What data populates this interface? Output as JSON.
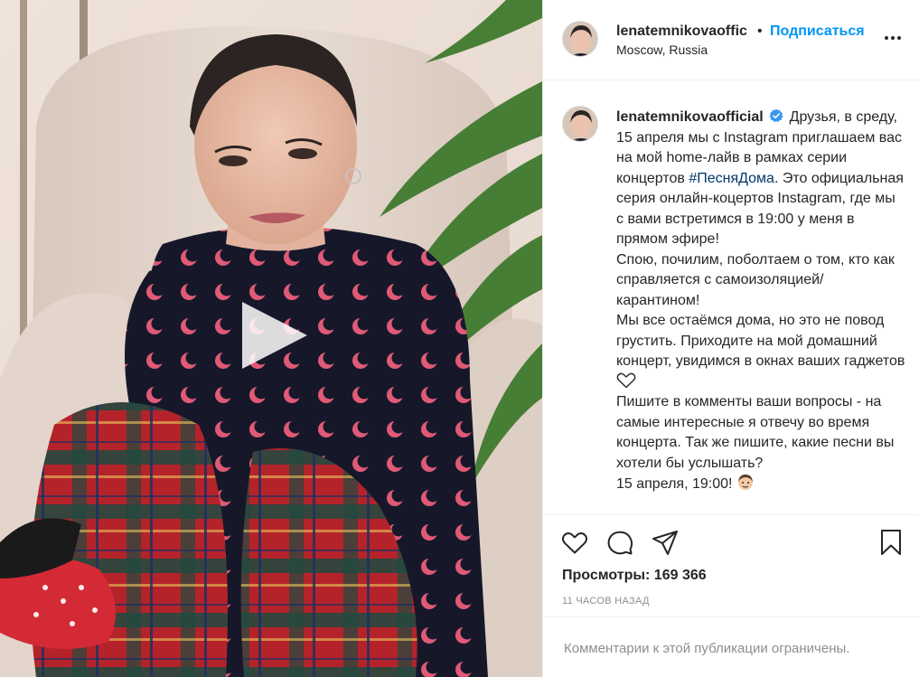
{
  "post": {
    "username_short": "lenatemnikovaoffic",
    "separator": "•",
    "follow_label": "Подписаться",
    "location": "Moscow, Russia",
    "more_icon": "more-horizontal-icon",
    "caption_username": "lenatemnikovaofficial",
    "verified_icon": "verified-badge-icon",
    "caption_part1": "Друзья, в среду, 15 апреля мы с Instagram приглашаем вас на мой home-лайв в рамках серии концертов ",
    "hashtag": "#ПесняДома",
    "caption_part2": ". Это официальная серия онлайн-коцертов Instagram, где мы с вами встретимся в 19:00 у меня в прямом эфире!",
    "caption_part3": "Спою, почилим, поболтаем о том, кто как справляется с самоизоляцией/карантином!",
    "caption_part4": "Мы все остаёмся дома, но это не повод грустить. Приходите на мой домашний концерт, увидимся в окнах ваших гаджетов ",
    "heart_emoji_icon": "white-heart-emoji-icon",
    "caption_part5": "Пишите в комменты ваши вопросы - на самые интересные я отвечу во время концерта. Так же пишите, какие песни вы хотели бы услышать?",
    "caption_part6": "15 апреля, 19:00! ",
    "end_emoji_icon": "person-emoji-icon",
    "views_label": "Просмотры:",
    "views_count": "169 366",
    "timestamp": "11 часов назад",
    "comments_restricted": "Комментарии к этой публикации ограничены."
  },
  "media": {
    "play_icon": "play-icon",
    "description_icons": [
      "chair",
      "plant",
      "woman-portrait"
    ]
  },
  "actions": {
    "like_icon": "heart-outline-icon",
    "comment_icon": "comment-bubble-icon",
    "share_icon": "paper-plane-icon",
    "save_icon": "bookmark-icon"
  },
  "colors": {
    "link_blue": "#0095f6",
    "hashtag_blue": "#00376b",
    "muted_gray": "#8e8e8e",
    "text": "#262626",
    "border": "#efefef"
  }
}
